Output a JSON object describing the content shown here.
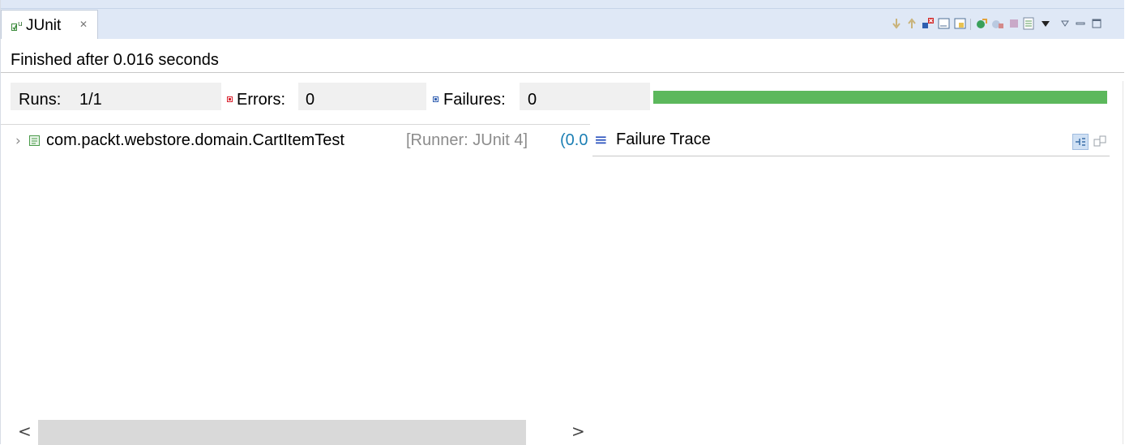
{
  "view": {
    "tab_title": "JUnit",
    "tab_close": "✕"
  },
  "toolbar": {
    "icons": [
      "next-failure-icon",
      "previous-failure-icon",
      "show-failures-only-icon",
      "scroll-lock-icon",
      "show-skipped-icon",
      "rerun-test-icon",
      "rerun-failed-first-icon",
      "stop-icon",
      "test-run-history-icon",
      "history-dropdown-icon",
      "view-menu-icon",
      "minimize-icon",
      "maximize-icon"
    ]
  },
  "status": "Finished after 0.016 seconds",
  "counters": {
    "runs_label": "Runs:",
    "runs_value": "1/1",
    "errors_label": "Errors:",
    "errors_value": "0",
    "failures_label": "Failures:",
    "failures_value": "0"
  },
  "progress": {
    "fraction": 1.0,
    "color": "#5cb85c"
  },
  "tree": {
    "items": [
      {
        "name": "com.packt.webstore.domain.CartItemTest",
        "runner": "[Runner: JUnit 4]",
        "time": "(0.0"
      }
    ]
  },
  "scrollbar": {
    "left": "<",
    "right": ">"
  },
  "trace": {
    "icon": "≡",
    "title": "Failure Trace"
  }
}
